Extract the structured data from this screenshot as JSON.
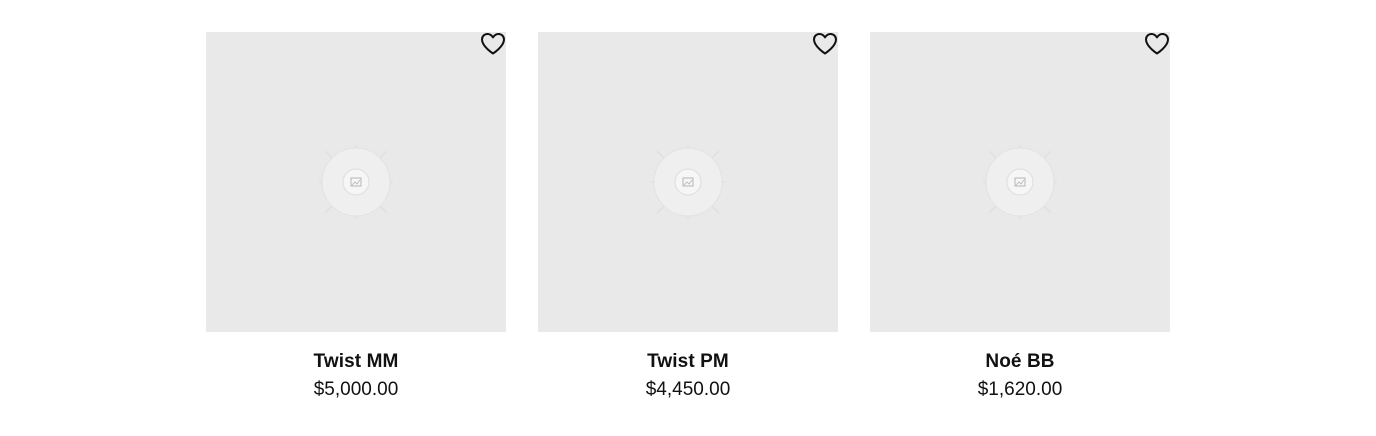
{
  "products": [
    {
      "name": "Twist MM",
      "price": "$5,000.00",
      "image_icon": "image-placeholder-icon",
      "wishlist_icon": "heart-icon"
    },
    {
      "name": "Twist PM",
      "price": "$4,450.00",
      "image_icon": "image-placeholder-icon",
      "wishlist_icon": "heart-icon"
    },
    {
      "name": "Noé BB",
      "price": "$1,620.00",
      "image_icon": "image-placeholder-icon",
      "wishlist_icon": "heart-icon"
    }
  ],
  "colors": {
    "image_bg": "#e9e9e9",
    "text": "#111111",
    "page_bg": "#ffffff"
  }
}
